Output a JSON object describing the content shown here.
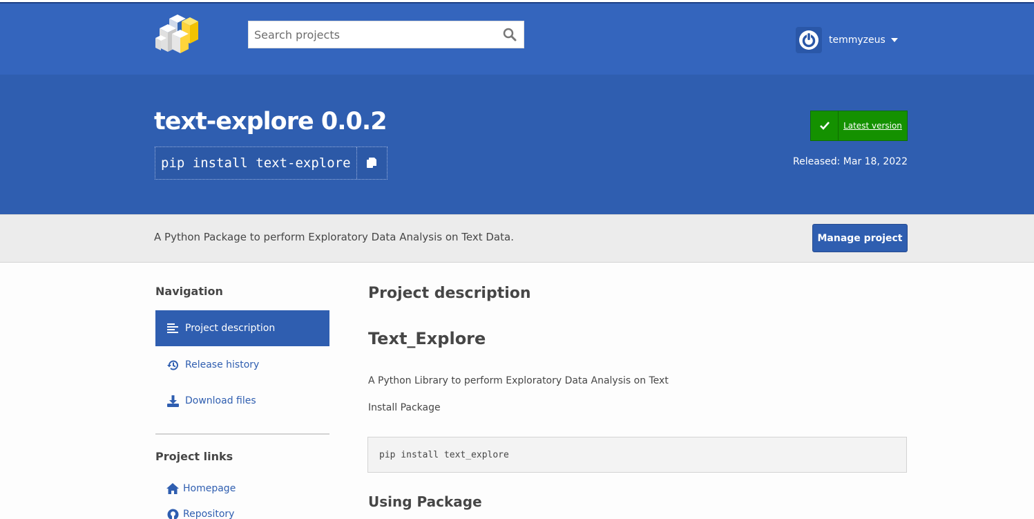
{
  "header": {
    "search_placeholder": "Search projects",
    "username": "temmyzeus"
  },
  "package": {
    "title": "text-explore 0.0.2",
    "pip_command": "pip install text-explore",
    "latest_label": "Latest version",
    "released": "Released: Mar 18, 2022"
  },
  "summary": {
    "text": "A Python Package to perform Exploratory Data Analysis on Text Data.",
    "manage_label": "Manage project"
  },
  "sidebar": {
    "heading": "Navigation",
    "items": [
      {
        "label": "Project description",
        "icon": "align-left-icon",
        "active": true
      },
      {
        "label": "Release history",
        "icon": "history-icon",
        "active": false
      },
      {
        "label": "Download files",
        "icon": "download-icon",
        "active": false
      }
    ],
    "links_heading": "Project links",
    "links": [
      {
        "label": "Homepage",
        "icon": "home-icon"
      },
      {
        "label": "Repository",
        "icon": "github-icon"
      }
    ]
  },
  "main": {
    "heading": "Project description",
    "readme_title": "Text_Explore",
    "readme_intro": "A Python Library to perform Exploratory Data Analysis on Text",
    "install_heading": "Install Package",
    "install_code": "pip install text_explore",
    "usage_heading": "Using Package"
  },
  "colors": {
    "brand_blue": "#3465bd",
    "banner_blue": "#2f5eb0",
    "latest_green": "#149100"
  }
}
